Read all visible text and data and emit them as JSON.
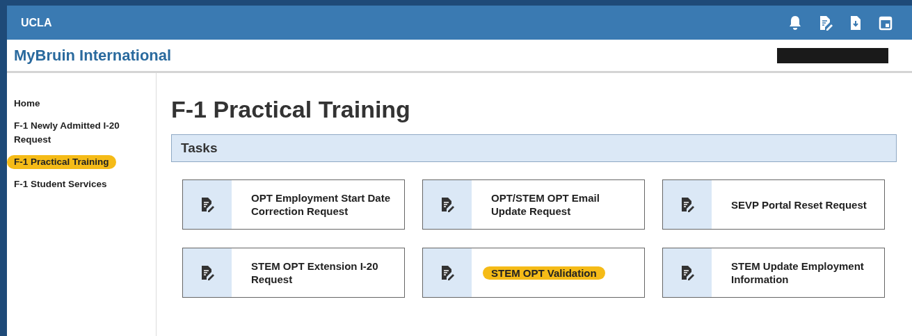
{
  "top_bar": {
    "brand": "UCLA"
  },
  "header": {
    "title": "MyBruin International"
  },
  "sidebar": {
    "items": [
      {
        "label": "Home",
        "selected": false
      },
      {
        "label": "F-1 Newly Admitted I-20 Request",
        "selected": false
      },
      {
        "label": "F-1 Practical Training",
        "selected": true
      },
      {
        "label": "F-1 Student Services",
        "selected": false
      }
    ]
  },
  "page": {
    "title": "F-1 Practical Training",
    "section": "Tasks",
    "tasks": [
      {
        "label": "OPT Employment Start Date Correction Request",
        "highlighted": false
      },
      {
        "label": "OPT/STEM OPT Email Update Request",
        "highlighted": false
      },
      {
        "label": "SEVP Portal Reset Request",
        "highlighted": false
      },
      {
        "label": "STEM OPT Extension I-20 Request",
        "highlighted": false
      },
      {
        "label": "STEM OPT Validation",
        "highlighted": true
      },
      {
        "label": "STEM Update Employment Information",
        "highlighted": false
      }
    ]
  }
}
